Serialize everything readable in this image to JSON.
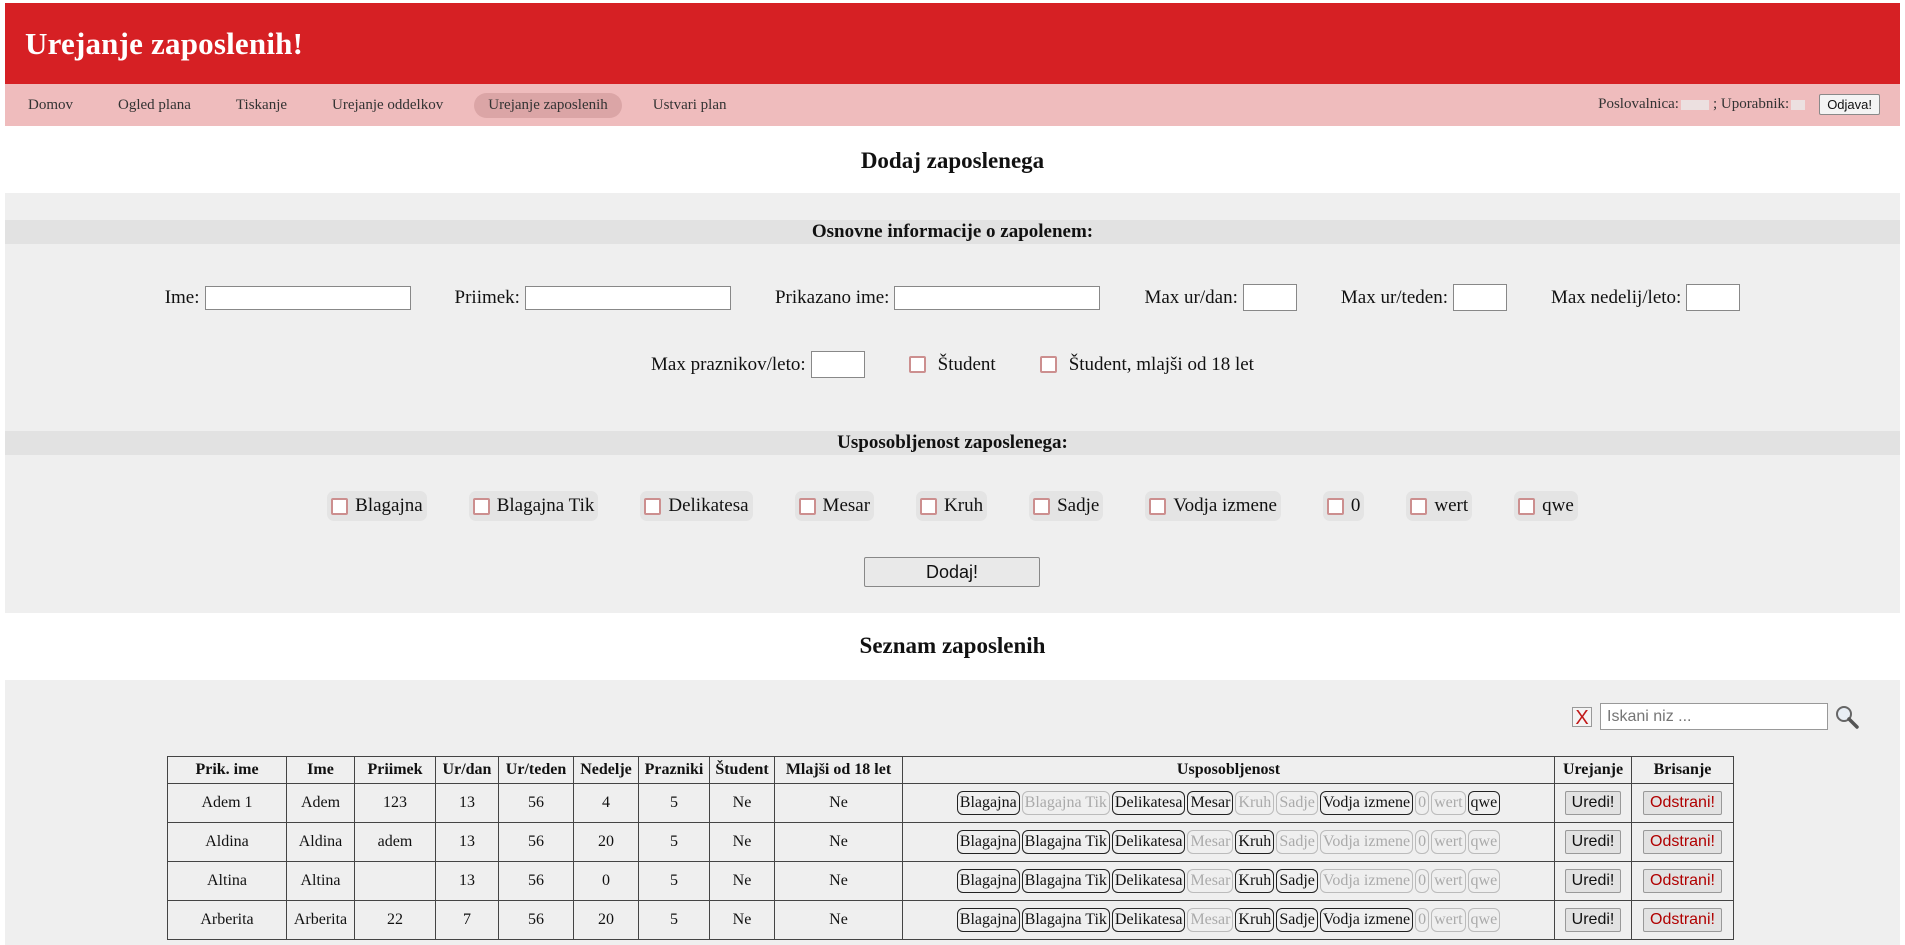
{
  "header": {
    "title": "Urejanje zaposlenih!"
  },
  "nav": {
    "items": [
      {
        "label": "Domov"
      },
      {
        "label": "Ogled plana"
      },
      {
        "label": "Tiskanje"
      },
      {
        "label": "Urejanje oddelkov"
      },
      {
        "label": "Urejanje zaposlenih"
      },
      {
        "label": "Ustvari plan"
      }
    ],
    "active": "Urejanje zaposlenih",
    "branch_label": "Poslovalnica:",
    "user_label": "; Uporabnik:",
    "logout_label": "Odjava!"
  },
  "add_section": {
    "title": "Dodaj zaposlenega",
    "basic_heading": "Osnovne informacije o zapolenem:",
    "fields": {
      "ime": "Ime:",
      "priimek": "Priimek:",
      "prikazano_ime": "Prikazano ime:",
      "max_ur_dan": "Max ur/dan:",
      "max_ur_teden": "Max ur/teden:",
      "max_nedelij": "Max nedelij/leto:",
      "max_praznikov": "Max praznikov/leto:"
    },
    "checkbox_student": "Študent",
    "checkbox_minor": "Študent, mlajši od 18 let",
    "skills_heading": "Usposobljenost zaposlenega:",
    "skills": [
      "Blagajna",
      "Blagajna Tik",
      "Delikatesa",
      "Mesar",
      "Kruh",
      "Sadje",
      "Vodja izmene",
      "0",
      "wert",
      "qwe"
    ],
    "add_button": "Dodaj!"
  },
  "list_section": {
    "title": "Seznam zaposlenih",
    "search_clear": "X",
    "search_placeholder": "Iskani niz ...",
    "columns": [
      "Prik. ime",
      "Ime",
      "Priimek",
      "Ur/dan",
      "Ur/teden",
      "Nedelje",
      "Prazniki",
      "Študent",
      "Mlajši od 18 let",
      "Usposobljenost",
      "Urejanje",
      "Brisanje"
    ],
    "edit_label": "Uredi!",
    "delete_label": "Odstrani!",
    "rows": [
      {
        "display": "Adem 1",
        "first": "Adem",
        "last": "123",
        "hday": "13",
        "hweek": "56",
        "sundays": "4",
        "holidays": "5",
        "student": "Ne",
        "minor": "Ne",
        "skills": [
          1,
          0,
          1,
          1,
          0,
          0,
          1,
          0,
          0,
          1
        ]
      },
      {
        "display": "Aldina",
        "first": "Aldina",
        "last": "adem",
        "hday": "13",
        "hweek": "56",
        "sundays": "20",
        "holidays": "5",
        "student": "Ne",
        "minor": "Ne",
        "skills": [
          1,
          1,
          1,
          0,
          1,
          0,
          0,
          0,
          0,
          0
        ]
      },
      {
        "display": "Altina",
        "first": "Altina",
        "last": "",
        "hday": "13",
        "hweek": "56",
        "sundays": "0",
        "holidays": "5",
        "student": "Ne",
        "minor": "Ne",
        "skills": [
          1,
          1,
          1,
          0,
          1,
          1,
          0,
          0,
          0,
          0
        ]
      },
      {
        "display": "Arberita",
        "first": "Arberita",
        "last": "22",
        "hday": "7",
        "hweek": "56",
        "sundays": "20",
        "holidays": "5",
        "student": "Ne",
        "minor": "Ne",
        "skills": [
          1,
          1,
          1,
          0,
          1,
          1,
          1,
          0,
          0,
          0
        ]
      }
    ]
  },
  "colors": {
    "banner": "#d62024",
    "nav": "#efbcbd",
    "active_nav": "#dba5a6",
    "panel": "#efefef",
    "subhead": "#e2e2e2",
    "delete_text": "#b00000"
  }
}
